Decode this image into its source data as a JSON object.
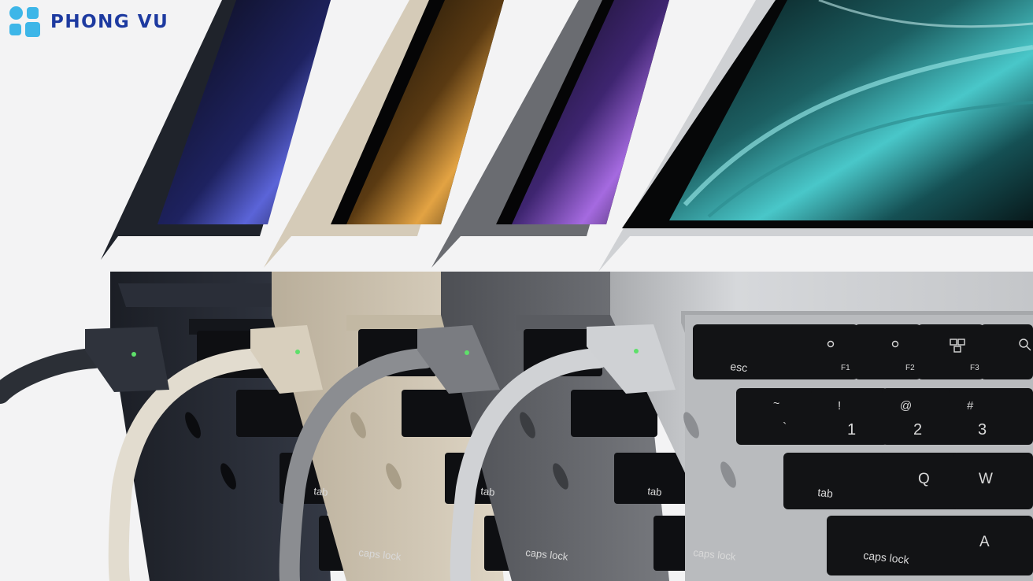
{
  "brand": {
    "logo_text": "PHONG VU",
    "logo_color": "#1d3aa0",
    "mark_color": "#3db6e8"
  },
  "scene": {
    "subject": "laptops",
    "laptop_colors": [
      "#262a33",
      "#d9cfbe",
      "#6d6f74",
      "#c9cbce"
    ],
    "screen_glow_colors": [
      "#5b64d8",
      "#e3a343",
      "#a56ae0",
      "#49c7c9"
    ],
    "cable_colors": [
      "#2b2f36",
      "#e2dccf",
      "#8b8d91",
      "#d0d2d5"
    ],
    "indicator_color": "#5ee06a"
  },
  "keyboard": {
    "esc": "esc",
    "f1": "F1",
    "f2": "F2",
    "f3": "F3",
    "tilde": "~",
    "backtick": "`",
    "exclaim": "!",
    "one": "1",
    "at": "@",
    "two": "2",
    "hash": "#",
    "three": "3",
    "tab": "tab",
    "q": "Q",
    "w": "W",
    "caps_lock": "caps lock",
    "a": "A"
  }
}
